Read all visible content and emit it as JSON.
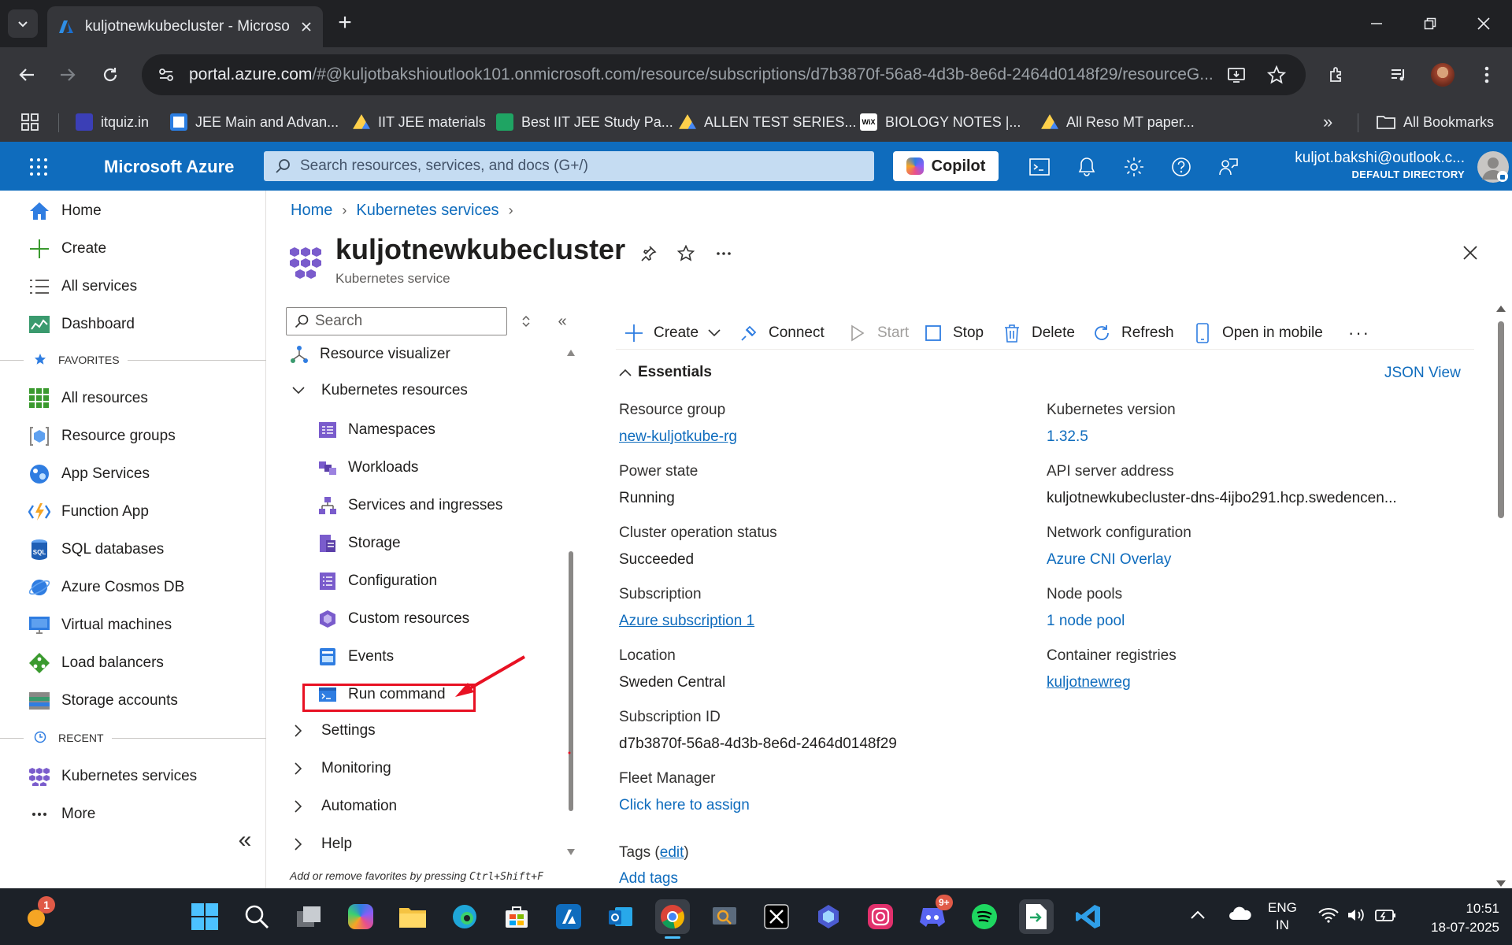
{
  "browser": {
    "tab_title": "kuljotnewkubecluster - Microso",
    "url_host": "portal.azure.com",
    "url_path": "/#@kuljotbakshioutlook101.onmicrosoft.com/resource/subscriptions/d7b3870f-56a8-4d3b-8e6d-2464d0148f29/resourceG...",
    "bookmarks": [
      "itquiz.in",
      "JEE Main and Advan...",
      "IIT JEE materials",
      "Best IIT JEE Study Pa...",
      "ALLEN TEST SERIES...",
      "BIOLOGY NOTES |...",
      "All Reso MT paper..."
    ],
    "bookmarks_overflow": "»",
    "all_bookmarks": "All Bookmarks"
  },
  "azure": {
    "brand": "Microsoft Azure",
    "search_placeholder": "Search resources, services, and docs (G+/)",
    "copilot": "Copilot",
    "account_email": "kuljot.bakshi@outlook.c...",
    "account_dir": "DEFAULT DIRECTORY"
  },
  "portal_nav": {
    "items": [
      "Home",
      "Create",
      "All services",
      "Dashboard"
    ],
    "favorites_header": "FAVORITES",
    "favorites": [
      "All resources",
      "Resource groups",
      "App Services",
      "Function App",
      "SQL databases",
      "Azure Cosmos DB",
      "Virtual machines",
      "Load balancers",
      "Storage accounts"
    ],
    "recent_header": "RECENT",
    "recent": [
      "Kubernetes services"
    ],
    "more": "More",
    "collapse": "«"
  },
  "breadcrumb": [
    "Home",
    "Kubernetes services"
  ],
  "resource": {
    "title": "kuljotnewkubecluster",
    "subtitle": "Kubernetes service"
  },
  "resource_menu": {
    "search_placeholder": "Search",
    "items": {
      "resource_visualizer": "Resource visualizer",
      "kubernetes_resources": "Kubernetes resources",
      "namespaces": "Namespaces",
      "workloads": "Workloads",
      "services_ingresses": "Services and ingresses",
      "storage": "Storage",
      "configuration": "Configuration",
      "custom_resources": "Custom resources",
      "events": "Events",
      "run_command": "Run command",
      "settings": "Settings",
      "monitoring": "Monitoring",
      "automation": "Automation",
      "help": "Help"
    },
    "hint_prefix": "Add or remove favorites by pressing ",
    "hint_keys": "Ctrl+Shift+F"
  },
  "commands": {
    "create": "Create",
    "connect": "Connect",
    "start": "Start",
    "stop": "Stop",
    "delete": "Delete",
    "refresh": "Refresh",
    "open_mobile": "Open in mobile",
    "more": "···"
  },
  "essentials": {
    "header": "Essentials",
    "json_view": "JSON View",
    "left": {
      "resource_group_label": "Resource group",
      "resource_group_value": "new-kuljotkube-rg",
      "power_state_label": "Power state",
      "power_state_value": "Running",
      "cluster_status_label": "Cluster operation status",
      "cluster_status_value": "Succeeded",
      "subscription_label": "Subscription",
      "subscription_value": "Azure subscription 1",
      "location_label": "Location",
      "location_value": "Sweden Central",
      "subscription_id_label": "Subscription ID",
      "subscription_id_value": "d7b3870f-56a8-4d3b-8e6d-2464d0148f29",
      "fleet_label": "Fleet Manager",
      "fleet_value": "Click here to assign",
      "tags_label": "Tags (",
      "tags_edit": "edit",
      "tags_close": ")",
      "add_tags": "Add tags"
    },
    "right": {
      "k8s_version_label": "Kubernetes version",
      "k8s_version_value": "1.32.5",
      "api_server_label": "API server address",
      "api_server_value": "kuljotnewkubecluster-dns-4ijbo291.hcp.swedencen...",
      "network_label": "Network configuration",
      "network_value": "Azure CNI Overlay",
      "node_pools_label": "Node pools",
      "node_pools_value": "1 node pool",
      "registries_label": "Container registries",
      "registries_value": "kuljotnewreg"
    }
  },
  "taskbar": {
    "weather_badge": "1",
    "discord_badge": "9+",
    "lang_top": "ENG",
    "lang_bottom": "IN",
    "time": "10:51",
    "date": "18-07-2025"
  },
  "colors": {
    "azure_blue": "#0f6cbd",
    "annotation_red": "#e81123",
    "chrome_dark": "#202124"
  }
}
